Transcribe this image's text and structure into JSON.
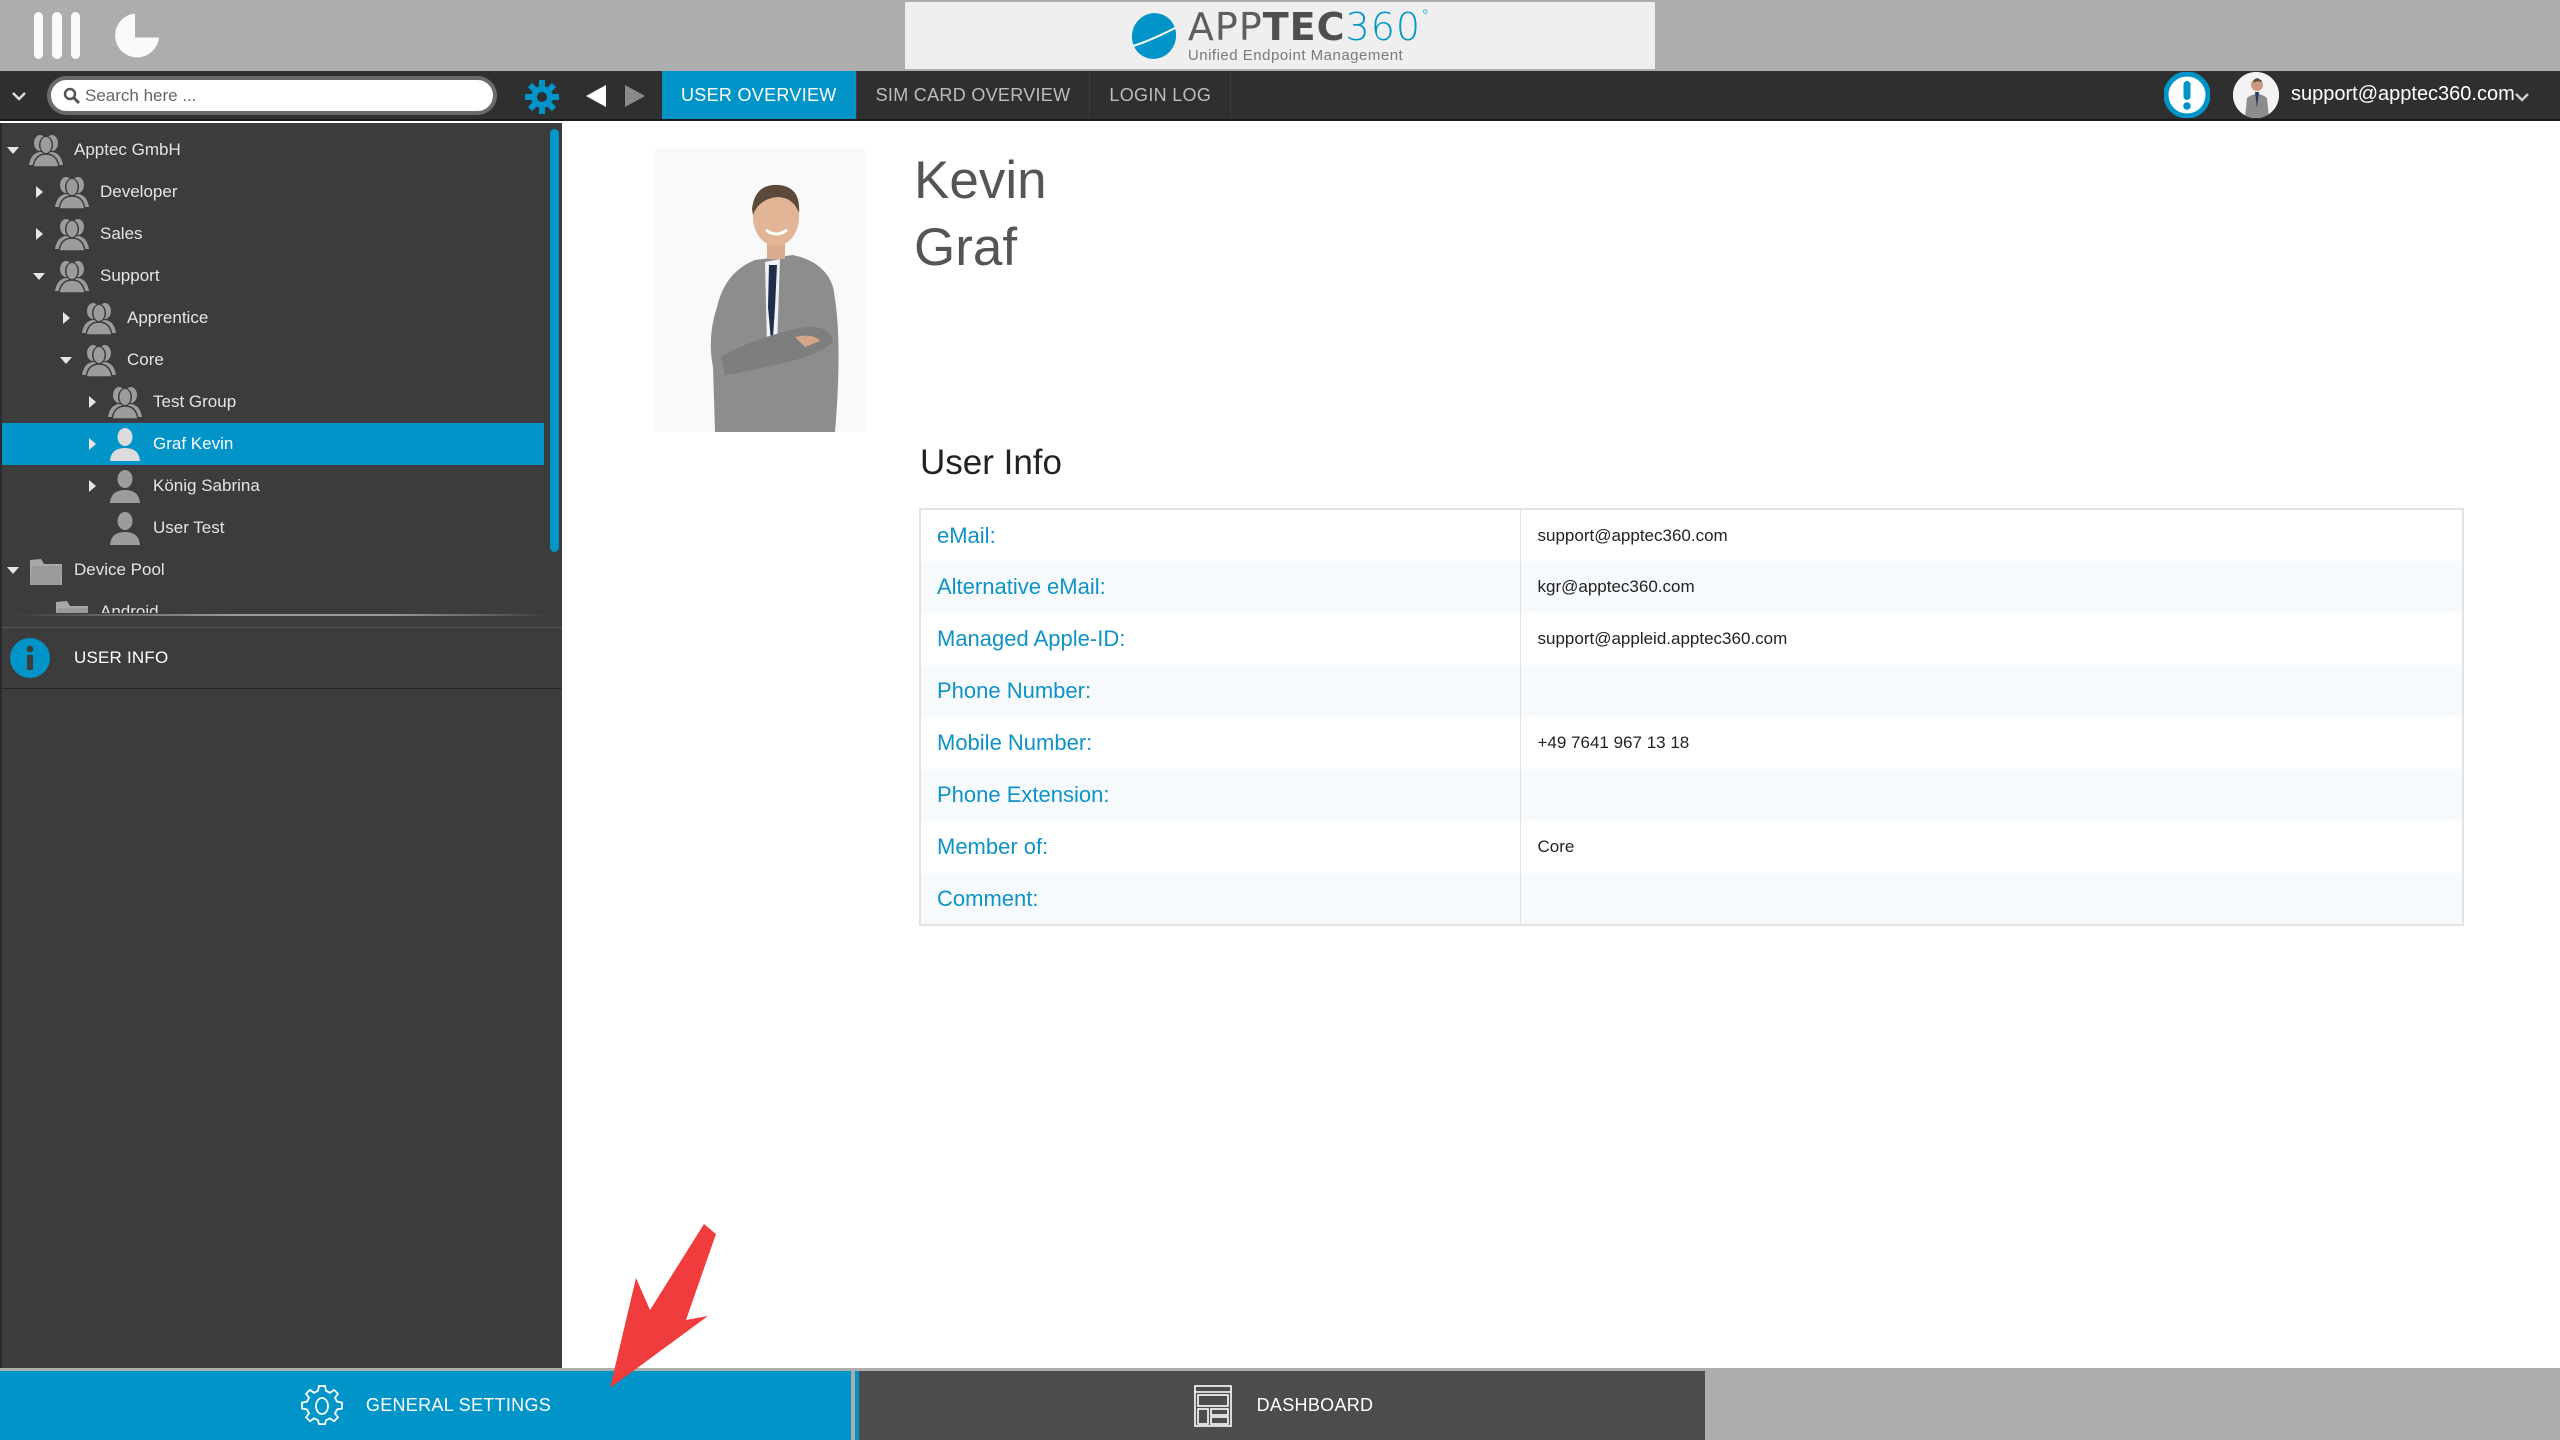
{
  "header": {
    "logo": {
      "brand_part1": "APP",
      "brand_part2": "TEC",
      "brand_part3": "360",
      "tagline": "Unified Endpoint Management"
    },
    "icons": [
      "menu-icon",
      "dashboard-pie-icon"
    ]
  },
  "navbar": {
    "search": {
      "placeholder": "Search here ...",
      "value": ""
    },
    "tabs": [
      {
        "label": "USER OVERVIEW",
        "active": true
      },
      {
        "label": "SIM CARD OVERVIEW",
        "active": false
      },
      {
        "label": "LOGIN LOG",
        "active": false
      }
    ],
    "account_email": "support@apptec360.com"
  },
  "sidebar": {
    "tree": [
      {
        "label": "Apptec GmbH",
        "type": "group",
        "level": 0,
        "expander": "expanded"
      },
      {
        "label": "Developer",
        "type": "group",
        "level": 1,
        "expander": "collapsed"
      },
      {
        "label": "Sales",
        "type": "group",
        "level": 1,
        "expander": "collapsed"
      },
      {
        "label": "Support",
        "type": "group",
        "level": 1,
        "expander": "expanded"
      },
      {
        "label": "Apprentice",
        "type": "group",
        "level": 2,
        "expander": "collapsed"
      },
      {
        "label": "Core",
        "type": "group",
        "level": 2,
        "expander": "expanded"
      },
      {
        "label": "Test Group",
        "type": "group",
        "level": 3,
        "expander": "collapsed"
      },
      {
        "label": "Graf Kevin",
        "type": "user",
        "level": 3,
        "expander": "collapsed",
        "selected": true
      },
      {
        "label": "König Sabrina",
        "type": "user",
        "level": 3,
        "expander": "collapsed"
      },
      {
        "label": "User Test",
        "type": "user",
        "level": 3,
        "expander": "none"
      },
      {
        "label": "Device Pool",
        "type": "folder",
        "level": 0,
        "expander": "expanded"
      },
      {
        "label": "Android",
        "type": "folder",
        "level": 1,
        "expander": "none"
      }
    ],
    "info_section_label": "USER INFO"
  },
  "profile": {
    "first_name": "Kevin",
    "last_name": "Graf",
    "section_title": "User Info",
    "fields": [
      {
        "label": "eMail:",
        "value": "support@apptec360.com"
      },
      {
        "label": "Alternative eMail:",
        "value": "kgr@apptec360.com"
      },
      {
        "label": "Managed Apple-ID:",
        "value": "support@appleid.apptec360.com"
      },
      {
        "label": "Phone Number:",
        "value": ""
      },
      {
        "label": "Mobile Number:",
        "value": "+49 7641 967 13 18"
      },
      {
        "label": "Phone Extension:",
        "value": ""
      },
      {
        "label": "Member of:",
        "value": "Core"
      },
      {
        "label": "Comment:",
        "value": ""
      }
    ]
  },
  "footer": {
    "general_settings_label": "GENERAL SETTINGS",
    "dashboard_label": "DASHBOARD"
  },
  "colors": {
    "accent": "#0094c8",
    "sidebar_bg": "#3c3c3c",
    "navbar_bg": "#2f2f2f",
    "topbar_bg": "#adadad",
    "field_label": "#0e93c6",
    "annotation_arrow": "#f03c3c"
  }
}
